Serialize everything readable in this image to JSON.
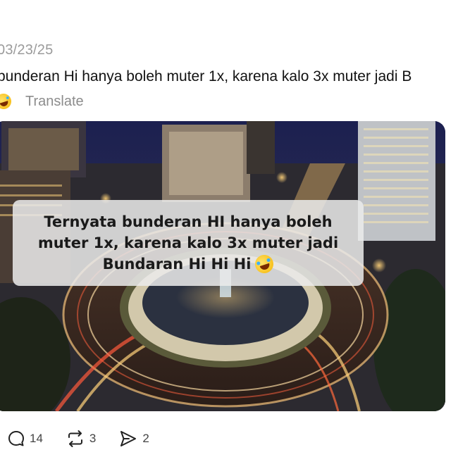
{
  "post": {
    "date": "03/23/25",
    "text": "bunderan Hi hanya boleh muter 1x, karena kalo 3x muter jadi B",
    "translate_label": "Translate",
    "emoji_icon": "rolling-laughing-emoji-icon"
  },
  "media": {
    "caption_line1": "Ternyata bunderan HI hanya boleh",
    "caption_line2": "muter 1x, karena kalo 3x muter jadi",
    "caption_line3": "Bundaran Hi Hi Hi"
  },
  "actions": {
    "replies": "14",
    "reposts": "3",
    "shares": "2"
  },
  "colors": {
    "muted_text": "#8c8c8c",
    "caption_bg": "#ebebeb"
  }
}
